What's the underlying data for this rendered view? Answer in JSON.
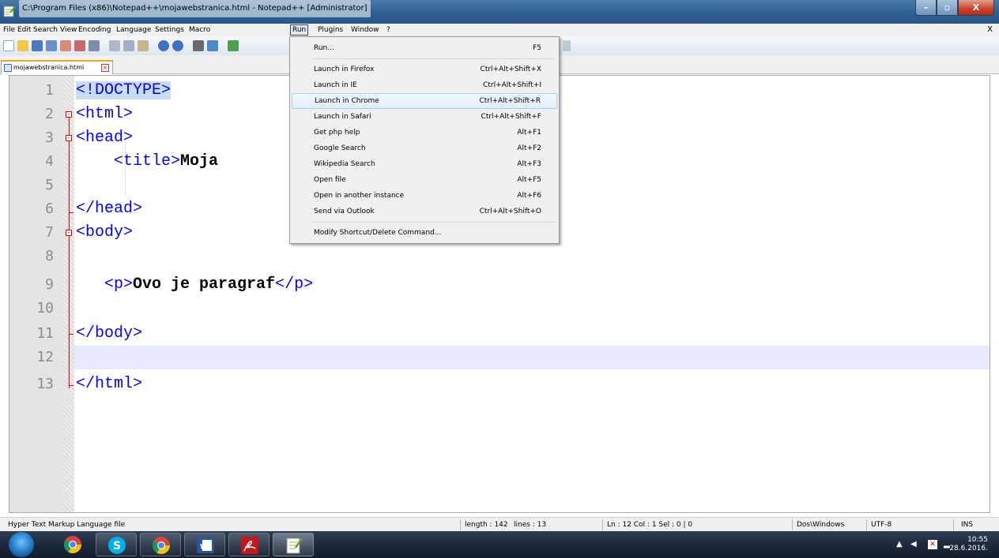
{
  "window": {
    "title": "C:\\Program Files (x86)\\Notepad++\\mojawebstranica.html - Notepad++ [Administrator]",
    "min_glyph": "–",
    "max_glyph": "▫",
    "close_glyph": "X"
  },
  "menu": {
    "items": [
      "File",
      "Edit",
      "Search",
      "View",
      "Encoding",
      "Language",
      "Settings",
      "Macro",
      "Run",
      "Plugins",
      "Window",
      "?"
    ],
    "active": "Run",
    "close_glyph": "X"
  },
  "tab": {
    "label": "mojawebstranica.html",
    "close_glyph": "×"
  },
  "editor": {
    "lines": [
      {
        "num": "1",
        "pre": "",
        "tag": "<!DOCTYPE>",
        "text": "",
        "tag2": ""
      },
      {
        "num": "2",
        "pre": "",
        "tag": "<html>",
        "text": "",
        "tag2": ""
      },
      {
        "num": "3",
        "pre": "",
        "tag": "<head>",
        "text": "",
        "tag2": ""
      },
      {
        "num": "4",
        "pre": "    ",
        "tag": "<title>",
        "text": "Moja",
        "tag2": ""
      },
      {
        "num": "5",
        "pre": "",
        "tag": "",
        "text": "",
        "tag2": ""
      },
      {
        "num": "6",
        "pre": "",
        "tag": "</head>",
        "text": "",
        "tag2": ""
      },
      {
        "num": "7",
        "pre": "",
        "tag": "<body>",
        "text": "",
        "tag2": ""
      },
      {
        "num": "8",
        "pre": "",
        "tag": "",
        "text": "",
        "tag2": ""
      },
      {
        "num": "9",
        "pre": "   ",
        "tag": "<p>",
        "text": "Ovo je paragraf",
        "tag2": "</p>"
      },
      {
        "num": "10",
        "pre": "",
        "tag": "",
        "text": "",
        "tag2": ""
      },
      {
        "num": "11",
        "pre": "",
        "tag": "</body>",
        "text": "",
        "tag2": ""
      },
      {
        "num": "12",
        "pre": "",
        "tag": "",
        "text": "",
        "tag2": ""
      },
      {
        "num": "13",
        "pre": "",
        "tag": "</html>",
        "text": "",
        "tag2": ""
      }
    ],
    "current_line": "12"
  },
  "run_menu": {
    "items": [
      {
        "label": "Run...",
        "shortcut": "F5"
      },
      {
        "label": "Launch in Firefox",
        "shortcut": "Ctrl+Alt+Shift+X"
      },
      {
        "label": "Launch in IE",
        "shortcut": "Ctrl+Alt+Shift+I"
      },
      {
        "label": "Launch in Chrome",
        "shortcut": "Ctrl+Alt+Shift+R"
      },
      {
        "label": "Launch in Safari",
        "shortcut": "Ctrl+Alt+Shift+F"
      },
      {
        "label": "Get php help",
        "shortcut": "Alt+F1"
      },
      {
        "label": "Google Search",
        "shortcut": "Alt+F2"
      },
      {
        "label": "Wikipedia Search",
        "shortcut": "Alt+F3"
      },
      {
        "label": "Open file",
        "shortcut": "Alt+F5"
      },
      {
        "label": "Open in another instance",
        "shortcut": "Alt+F6"
      },
      {
        "label": "Send via Outlook",
        "shortcut": "Ctrl+Alt+Shift+O"
      },
      {
        "label": "Modify Shortcut/Delete Command...",
        "shortcut": ""
      }
    ],
    "highlighted": "Launch in Chrome"
  },
  "status": {
    "file_type": "Hyper Text Markup Language file",
    "length": "length : 142",
    "lines": "lines : 13",
    "position": "Ln : 12   Col : 1   Sel : 0 | 0",
    "eol": "Dos\\Windows",
    "encoding": "UTF-8",
    "mode": "INS"
  },
  "taskbar": {
    "time": "10:55",
    "date": "28.6.2016.",
    "apps": [
      "chrome-icon",
      "skype-icon",
      "chrome-icon",
      "word-icon",
      "acrobat-icon",
      "notepadpp-icon"
    ]
  },
  "colors": {
    "tag": "#0000ff",
    "text": "#000000",
    "current_line_bg": "#e8e8ff",
    "fold_marker": "#e00000",
    "tab_accent": "#f5a623",
    "menu_highlight": "#e2effb"
  }
}
